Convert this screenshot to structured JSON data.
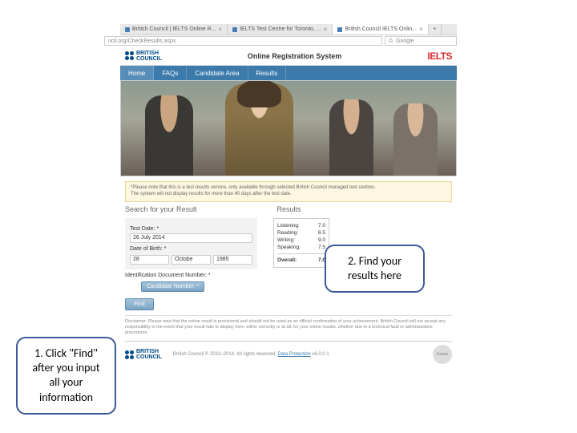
{
  "browser": {
    "tabs": [
      {
        "label": "British Council | IELTS Online R..."
      },
      {
        "label": "IELTS Test Centre for Toronto, ..."
      },
      {
        "label": "British Council IELTS Onlin..."
      }
    ],
    "url": "ncil.org/CheckResults.aspx",
    "search_placeholder": "Google"
  },
  "header": {
    "bc_line1": "BRITISH",
    "bc_line2": "COUNCIL",
    "title": "Online Registration System",
    "ielts": "IELTS"
  },
  "nav": [
    "Home",
    "FAQs",
    "Candidate Area",
    "Results"
  ],
  "notice": {
    "line1": "*Please note that this is a test results service, only available through selected British Council managed test centres.",
    "line2": "The system will not display results for more than 40 days after the test date."
  },
  "sections": {
    "search": "Search for your Result",
    "results": "Results"
  },
  "form": {
    "test_date_label": "Test Date: *",
    "test_date_value": "26 July 2014",
    "dob_label": "Date of Birth: *",
    "dob_day": "28",
    "dob_month": "Octobe",
    "dob_year": "1985",
    "id_label": "Identification Document Number: *",
    "cand_label": "Candidate Number: *",
    "find": "Find"
  },
  "results": {
    "listening_label": "Listening:",
    "listening": "7.0",
    "reading_label": "Reading:",
    "reading": "8.5",
    "writing_label": "Writing:",
    "writing": "9.0",
    "speaking_label": "Speaking:",
    "speaking": "7.5",
    "overall_label": "Overall:",
    "overall": "7.0"
  },
  "disclaimer": "Disclaimer: Please note that the online result is provisional and should not be used as an official confirmation of your achievement. British Council will not accept any responsibility in the event that your result fails to display here, either correctly or at all, for your online results, whether due to a technical fault or administrative procedures.",
  "footer": {
    "bc1": "BRITISH",
    "bc2": "COUNCIL",
    "copyright": "British Council © 2010–2014. All rights reserved.",
    "link": "Data Protection",
    "version": "v6.0.0.1",
    "badge": "thawte"
  },
  "callouts": {
    "c1": "1. Click \"Find\" after you input all your information",
    "c2": "2. Find your results here"
  }
}
